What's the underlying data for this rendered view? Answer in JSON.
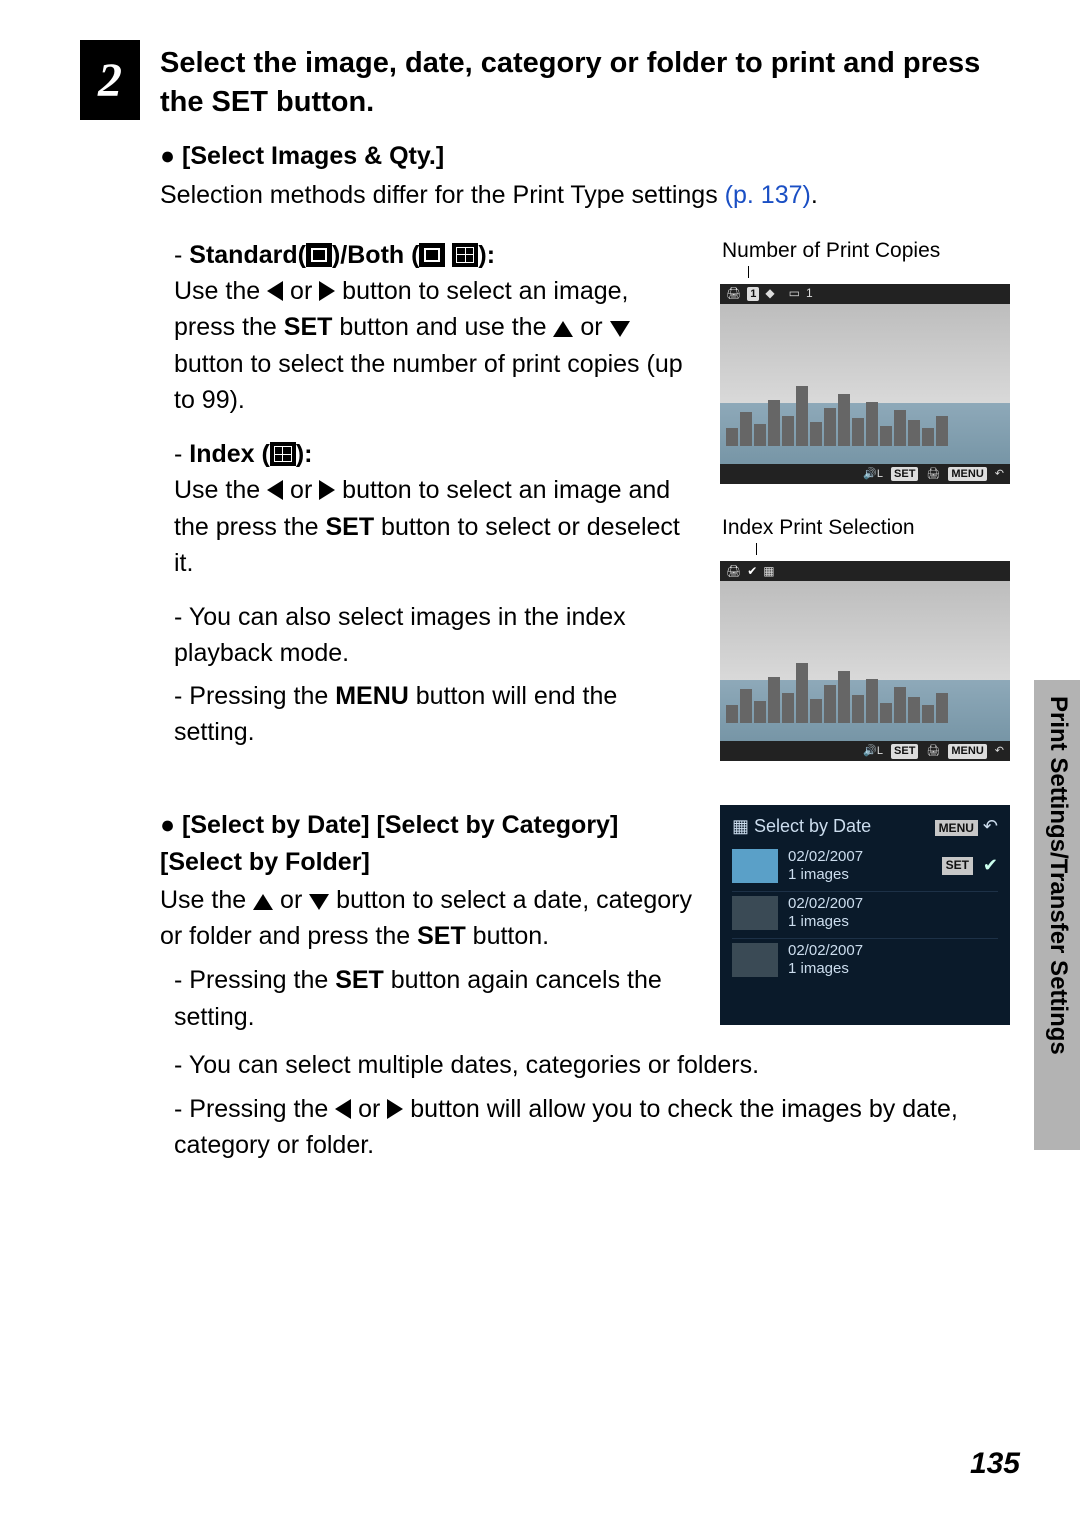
{
  "step": {
    "number": "2",
    "title": "Select the image, date, category or folder to print and press the SET button."
  },
  "section1": {
    "heading": "[Select Images & Qty.]",
    "para_a": "Selection methods differ for the Print Type settings ",
    "link": "(p. 137)",
    "para_b": "."
  },
  "standard": {
    "title_a": "Standard(",
    "title_b": ")/Both (",
    "title_c": "):",
    "p1a": "Use the ",
    "p1b": " or ",
    "p1c": " button to select an image, press the ",
    "set": "SET",
    "p1d": " button and use the ",
    "p1e": " or ",
    "p1f": " button to select the number of print copies (up to 99)."
  },
  "index": {
    "title_a": "Index (",
    "title_b": "):",
    "p1a": "Use the ",
    "p1b": " or ",
    "p1c": " button to select an image and the press the ",
    "set": "SET",
    "p1d": " button to select or deselect it."
  },
  "notes1": {
    "l1": "You can also select images in the index playback mode.",
    "l2a": "Pressing the ",
    "menu": "MENU",
    "l2b": " button will end the setting."
  },
  "section2": {
    "heading": "[Select by Date] [Select by Category] [Select by Folder]",
    "p1a": "Use the ",
    "p1b": " or ",
    "p1c": " button to select a date, category or folder and press the ",
    "set": "SET",
    "p1d": " button.",
    "b1a": "Pressing the ",
    "b1b": " button again cancels the setting.",
    "b2": "You can select multiple dates, categories or folders.",
    "b3a": "Pressing the ",
    "b3b": " or ",
    "b3c": " button will allow you to check the images by date, category or folder."
  },
  "right": {
    "caption1": "Number of Print Copies",
    "caption2": "Index Print Selection",
    "menuTitle": "Select by Date",
    "menuBadge": "MENU",
    "setBadge": "SET",
    "screen_set": "SET",
    "screen_menu": "MENU",
    "rows": [
      {
        "date": "02/02/2007",
        "count": "1 images",
        "selected": true
      },
      {
        "date": "02/02/2007",
        "count": "1 images",
        "selected": false
      },
      {
        "date": "02/02/2007",
        "count": "1 images",
        "selected": false
      }
    ],
    "topbar_a": "1",
    "topbar_b": "1"
  },
  "sideTab": "Print Settings/Transfer Settings",
  "pageNumber": "135"
}
